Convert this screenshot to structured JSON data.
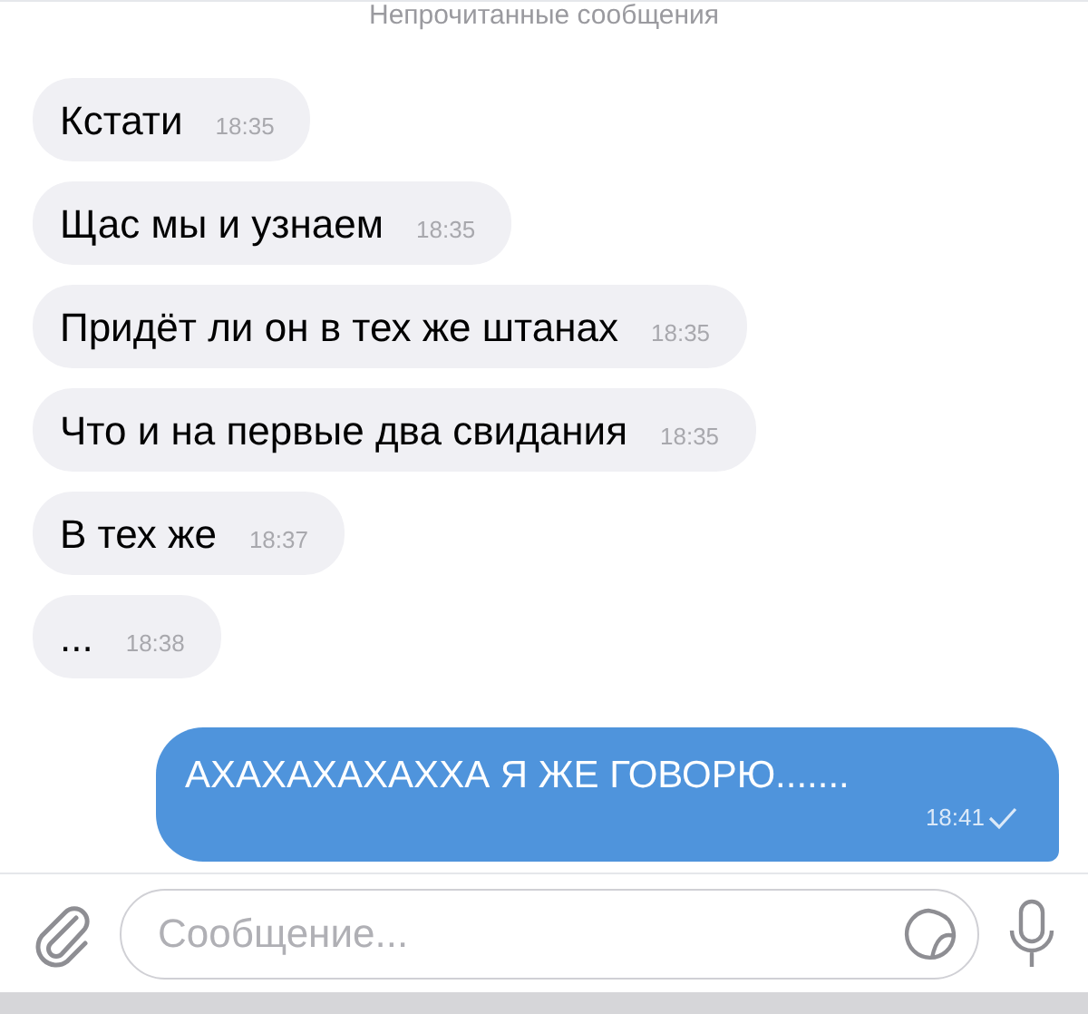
{
  "unread_divider": "Непрочитанные сообщения",
  "messages": [
    {
      "kind": "incoming",
      "text": "Кстати",
      "time": "18:35"
    },
    {
      "kind": "incoming",
      "text": "Щас мы и узнаем",
      "time": "18:35"
    },
    {
      "kind": "incoming",
      "text": "Придёт ли он в тех же штанах",
      "time": "18:35"
    },
    {
      "kind": "incoming",
      "text": "Что и на первые два свидания",
      "time": "18:35"
    },
    {
      "kind": "incoming",
      "text": "В тех же",
      "time": "18:37"
    },
    {
      "kind": "incoming",
      "text": "...",
      "time": "18:38"
    },
    {
      "kind": "outgoing",
      "text": "АХАХАХАХАХХА Я ЖЕ ГОВОРЮ.......",
      "time": "18:41",
      "sent": true
    }
  ],
  "composer": {
    "placeholder": "Сообщение..."
  }
}
